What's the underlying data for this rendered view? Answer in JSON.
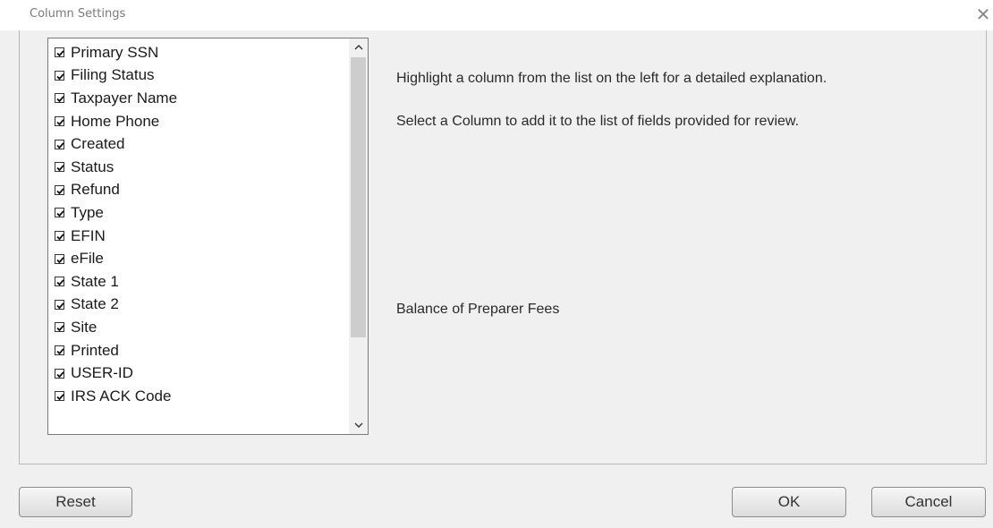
{
  "window": {
    "title": "Column Settings",
    "close_glyph": "✕"
  },
  "columns": [
    {
      "label": "Primary SSN",
      "checked": true
    },
    {
      "label": "Filing Status",
      "checked": true
    },
    {
      "label": "Taxpayer Name",
      "checked": true
    },
    {
      "label": "Home Phone",
      "checked": true
    },
    {
      "label": "Created",
      "checked": true
    },
    {
      "label": "Status",
      "checked": true
    },
    {
      "label": "Refund",
      "checked": true
    },
    {
      "label": "Type",
      "checked": true
    },
    {
      "label": "EFIN",
      "checked": true
    },
    {
      "label": "eFile",
      "checked": true
    },
    {
      "label": "State 1",
      "checked": true
    },
    {
      "label": "State 2",
      "checked": true
    },
    {
      "label": "Site",
      "checked": true
    },
    {
      "label": "Printed",
      "checked": true
    },
    {
      "label": "USER-ID",
      "checked": true
    },
    {
      "label": "IRS ACK Code",
      "checked": true
    }
  ],
  "description": {
    "line1": "Highlight a column from the list on the left for a detailed explanation.",
    "line2": "Select a Column to add it to the list of fields provided for review.",
    "detail": "Balance of Preparer Fees"
  },
  "buttons": {
    "reset": "Reset",
    "ok": "OK",
    "cancel": "Cancel"
  },
  "colors": {
    "dialog_bg": "#f0f0f0",
    "scroll_thumb": "#cdcdcd"
  },
  "icons": {
    "close": "close-icon",
    "scroll_up": "chevron-up-icon",
    "scroll_down": "chevron-down-icon",
    "checkbox": "checkbox-checked-icon"
  }
}
